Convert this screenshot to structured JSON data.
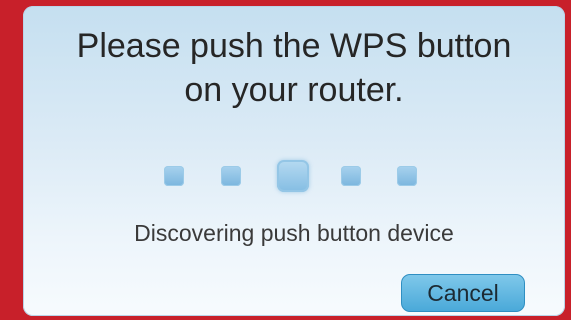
{
  "dialog": {
    "title": "Please push the WPS button\non your router.",
    "status": "Discovering push button device",
    "cancel_label": "Cancel"
  },
  "progress": {
    "steps": 5,
    "active_step": 3
  },
  "colors": {
    "accent": "#4aa9d9",
    "frame": "#c8202a",
    "dialog_bg": "#dcebf6"
  }
}
